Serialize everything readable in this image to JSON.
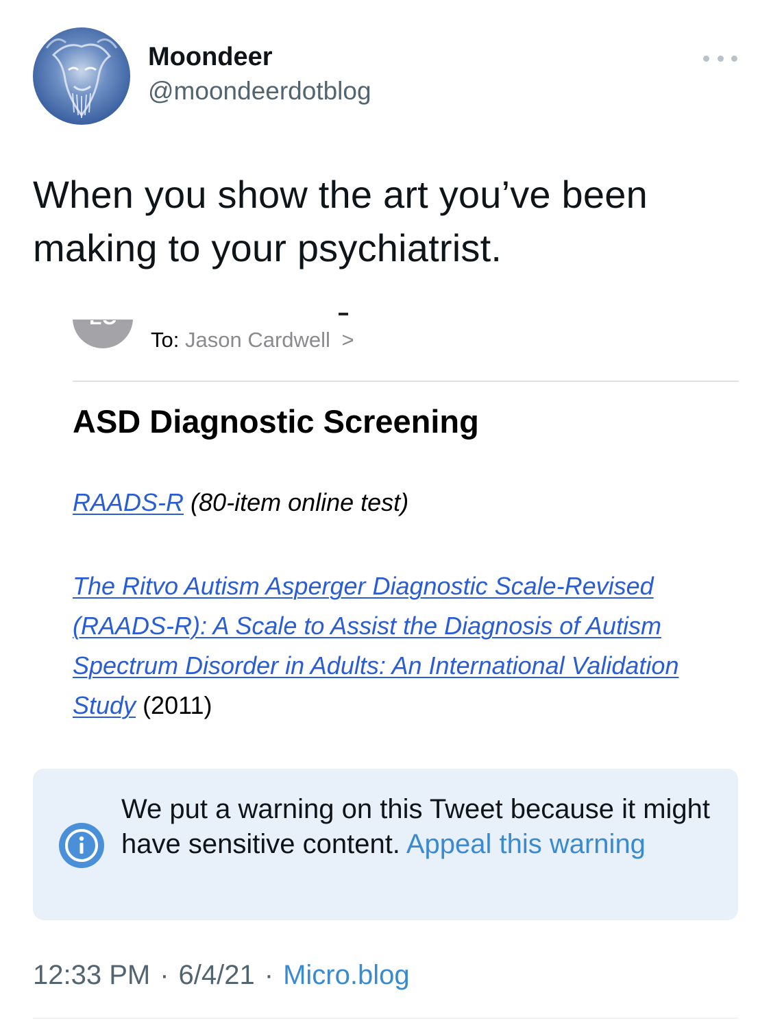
{
  "author": {
    "display_name": "Moondeer",
    "handle": "@moondeerdotblog"
  },
  "tweet": {
    "text": "When you show the art you’ve been making to your psychiatrist."
  },
  "email": {
    "avatar_initials": "LC",
    "to_label": "To:",
    "recipient": "Jason Cardwell",
    "chevron": ">",
    "subject": "ASD Diagnostic Screening",
    "line1_link": "RAADS-R",
    "line1_rest": "(80-item online test)",
    "paper_link": "The Ritvo Autism Asperger Diagnostic Scale-Revised (RAADS-R): A Scale to Assist the Diagnosis of Autism Spectrum Disorder in Adults: An International Validation Study",
    "paper_year": "(2011)"
  },
  "warning": {
    "text": "We put a warning on this Tweet because it might have sensitive content.",
    "appeal_link": "Appeal this warning"
  },
  "meta": {
    "time": "12:33 PM",
    "separator": "·",
    "date": "6/4/21",
    "source": "Micro.blog"
  },
  "colors": {
    "link_blue": "#2a5cd4",
    "twitter_blue": "#3a8ad0",
    "warning_bg": "#e8f1fa",
    "info_icon": "#4a90d9"
  }
}
